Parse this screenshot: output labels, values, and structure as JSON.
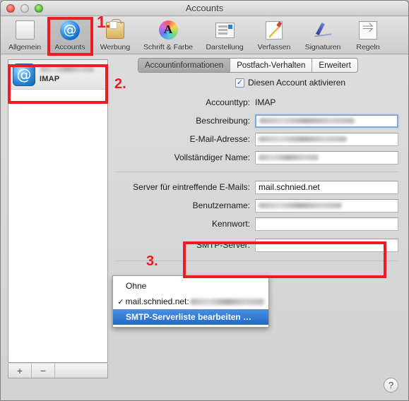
{
  "window": {
    "title": "Accounts",
    "controls": {
      "close": "close-button",
      "minimize": "minimize-button",
      "zoom": "zoom-button"
    }
  },
  "toolbar": {
    "items": [
      {
        "label": "Allgemein",
        "icon": "general-icon",
        "selected": false
      },
      {
        "label": "Accounts",
        "icon": "at-sign-icon",
        "selected": true
      },
      {
        "label": "Werbung",
        "icon": "junk-bag-icon",
        "selected": false
      },
      {
        "label": "Schrift & Farbe",
        "icon": "color-wheel-icon",
        "selected": false
      },
      {
        "label": "Darstellung",
        "icon": "viewing-icon",
        "selected": false
      },
      {
        "label": "Verfassen",
        "icon": "compose-pen-icon",
        "selected": false
      },
      {
        "label": "Signaturen",
        "icon": "signature-pen-icon",
        "selected": false
      },
      {
        "label": "Regeln",
        "icon": "rules-arrows-icon",
        "selected": false
      }
    ]
  },
  "sidebar": {
    "account": {
      "name_redacted": true,
      "type": "IMAP",
      "icon": "account-at-icon"
    },
    "add_button": "+",
    "remove_button": "−"
  },
  "tabs": [
    {
      "label": "Accountinformationen",
      "active": true
    },
    {
      "label": "Postfach-Verhalten",
      "active": false
    },
    {
      "label": "Erweitert",
      "active": false
    }
  ],
  "form": {
    "enable_account_label": "Diesen Account aktivieren",
    "enable_account_checked": true,
    "checkmark": "✓",
    "fields": [
      {
        "label": "Accounttyp:",
        "value": "IMAP",
        "kind": "static"
      },
      {
        "label": "Beschreibung:",
        "value": "",
        "kind": "input",
        "redacted": true,
        "focused": true
      },
      {
        "label": "E-Mail-Adresse:",
        "value": "",
        "kind": "input",
        "redacted": true,
        "focused": false
      },
      {
        "label": "Vollständiger Name:",
        "value": "",
        "kind": "input",
        "redacted": true,
        "focused": false
      },
      {
        "label": "Server für eintreffende E-Mails:",
        "value": "mail.schnied.net",
        "kind": "input",
        "redacted": false,
        "focused": false
      },
      {
        "label": "Benutzername:",
        "value": "",
        "kind": "input",
        "redacted": true,
        "focused": false
      },
      {
        "label": "Kennwort:",
        "value": "",
        "kind": "input",
        "redacted": true,
        "focused": false
      },
      {
        "label": "SMTP-Server:",
        "value": "",
        "kind": "popup",
        "redacted": true,
        "focused": false
      }
    ]
  },
  "smtp_menu": {
    "items": [
      {
        "label": "Ohne",
        "checked": false,
        "highlighted": false,
        "redacted_suffix": false
      },
      {
        "label": "mail.schnied.net:",
        "checked": true,
        "highlighted": false,
        "redacted_suffix": true
      },
      {
        "label": "SMTP-Serverliste bearbeiten …",
        "checked": false,
        "highlighted": true,
        "redacted_suffix": false
      }
    ]
  },
  "help_button": "?",
  "annotations": {
    "accent_color": "#ec1c24",
    "numbers": [
      {
        "id": "num1",
        "text": "1."
      },
      {
        "id": "num2",
        "text": "2."
      },
      {
        "id": "num3",
        "text": "3."
      }
    ],
    "boxes": [
      "accounts-toolbar-item",
      "sidebar-account-row",
      "smtp-server-popup"
    ]
  }
}
